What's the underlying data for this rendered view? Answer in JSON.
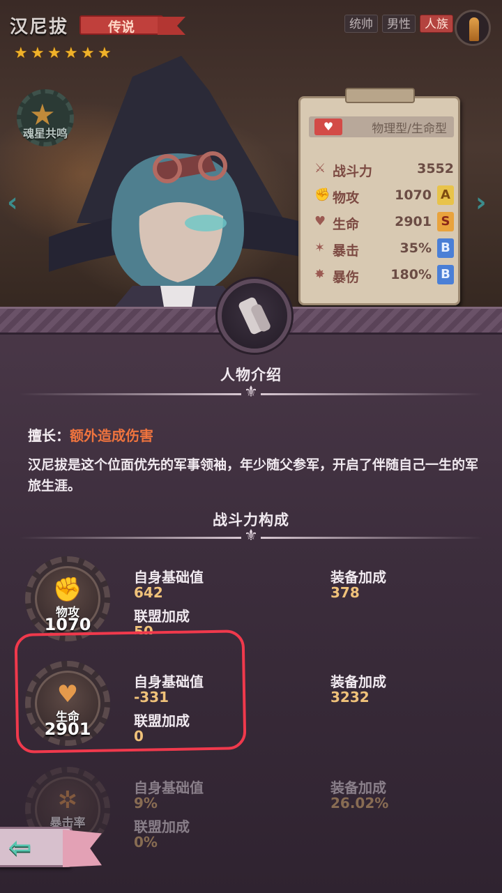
{
  "hero": {
    "name": "汉尼拔",
    "rarity": "传说",
    "stars": [
      "★",
      "★",
      "★",
      "★",
      "★",
      "★"
    ],
    "tags": [
      "统帅",
      "男性",
      "人族"
    ],
    "resonance_label": "魂星共鸣",
    "nav_left": "‹",
    "nav_right": "›"
  },
  "stats_board": {
    "type": "物理型/生命型",
    "power": {
      "icon": "⚔",
      "label": "战斗力",
      "value": "3552"
    },
    "rows": [
      {
        "icon": "✊",
        "label": "物攻",
        "value": "1070",
        "grade": "A"
      },
      {
        "icon": "♥",
        "label": "生命",
        "value": "2901",
        "grade": "S"
      },
      {
        "icon": "✶",
        "label": "暴击",
        "value": "35%",
        "grade": "B"
      },
      {
        "icon": "✸",
        "label": "暴伤",
        "value": "180%",
        "grade": "B"
      }
    ]
  },
  "intro": {
    "title": "人物介绍",
    "specialty_label": "擅长：",
    "specialty_value": "额外造成伤害",
    "description": "汉尼拔是这个位面优先的军事领袖，年少随父参军，开启了伴随自己一生的军旅生涯。"
  },
  "power_breakdown": {
    "title": "战斗力构成",
    "rows": [
      {
        "icon": "✊",
        "name": "物攻",
        "total": "1070",
        "base_label": "自身基础值",
        "base": "642",
        "equip_label": "装备加成",
        "equip": "378",
        "alliance_label": "联盟加成",
        "alliance": "50"
      },
      {
        "icon": "♥",
        "name": "生命",
        "total": "2901",
        "base_label": "自身基础值",
        "base": "-331",
        "equip_label": "装备加成",
        "equip": "3232",
        "alliance_label": "联盟加成",
        "alliance": "0"
      },
      {
        "icon": "✲",
        "name": "暴击率",
        "total": "",
        "base_label": "自身基础值",
        "base": "9%",
        "equip_label": "装备加成",
        "equip": "26.02%",
        "alliance_label": "联盟加成",
        "alliance": "0%"
      }
    ]
  },
  "back_button": {
    "arrow": "⇦"
  },
  "colors": {
    "accent_orange": "#f0743e",
    "highlight_red": "#f0394c",
    "number_gold": "#f0c27a"
  }
}
